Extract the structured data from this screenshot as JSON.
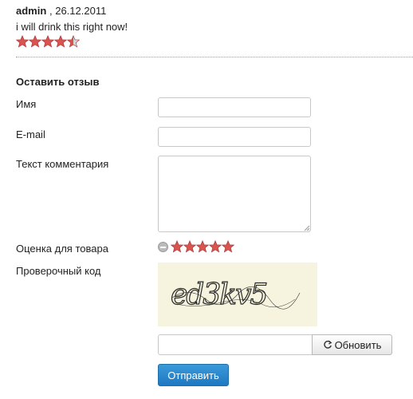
{
  "review": {
    "author": "admin",
    "date": ", 26.12.2011",
    "text": "i will drink this right now!",
    "rating": 4.5,
    "rating_max": 5
  },
  "form": {
    "title": "Оставить отзыв",
    "name_label": "Имя",
    "name_value": "",
    "email_label": "E-mail",
    "email_value": "",
    "comment_label": "Текст комментария",
    "comment_value": "",
    "rating_label": "Оценка для товара",
    "rating_value": 5,
    "captcha_label": "Проверочный код",
    "captcha_image_text": "ed3kv5",
    "captcha_value": "",
    "refresh_label": "Обновить",
    "submit_label": "Отправить"
  },
  "colors": {
    "star": "#d9534f",
    "star_empty": "#d6d6d6",
    "primary": "#2a88cf",
    "captcha_bg": "#f6f4de"
  }
}
